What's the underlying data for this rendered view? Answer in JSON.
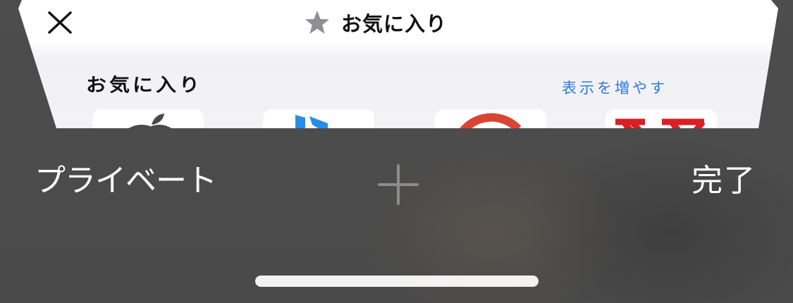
{
  "card": {
    "title": "お気に入り",
    "section_heading": "お気に入り",
    "show_more": "表示を増やす",
    "favorites": [
      {
        "icon": "apple-icon"
      },
      {
        "icon": "bing-icon"
      },
      {
        "icon": "google-icon"
      },
      {
        "icon": "yahoo-icon"
      }
    ]
  },
  "toolbar": {
    "private_label": "プライベート",
    "done_label": "完了",
    "new_tab_icon": "plus-icon"
  },
  "colors": {
    "link": "#2f7ae5",
    "toolbar_bg": "#4a4a4a",
    "star": "#8e8e93",
    "bing": "#2b8be8",
    "google": "#d94535",
    "yahoo": "#d81f26"
  }
}
